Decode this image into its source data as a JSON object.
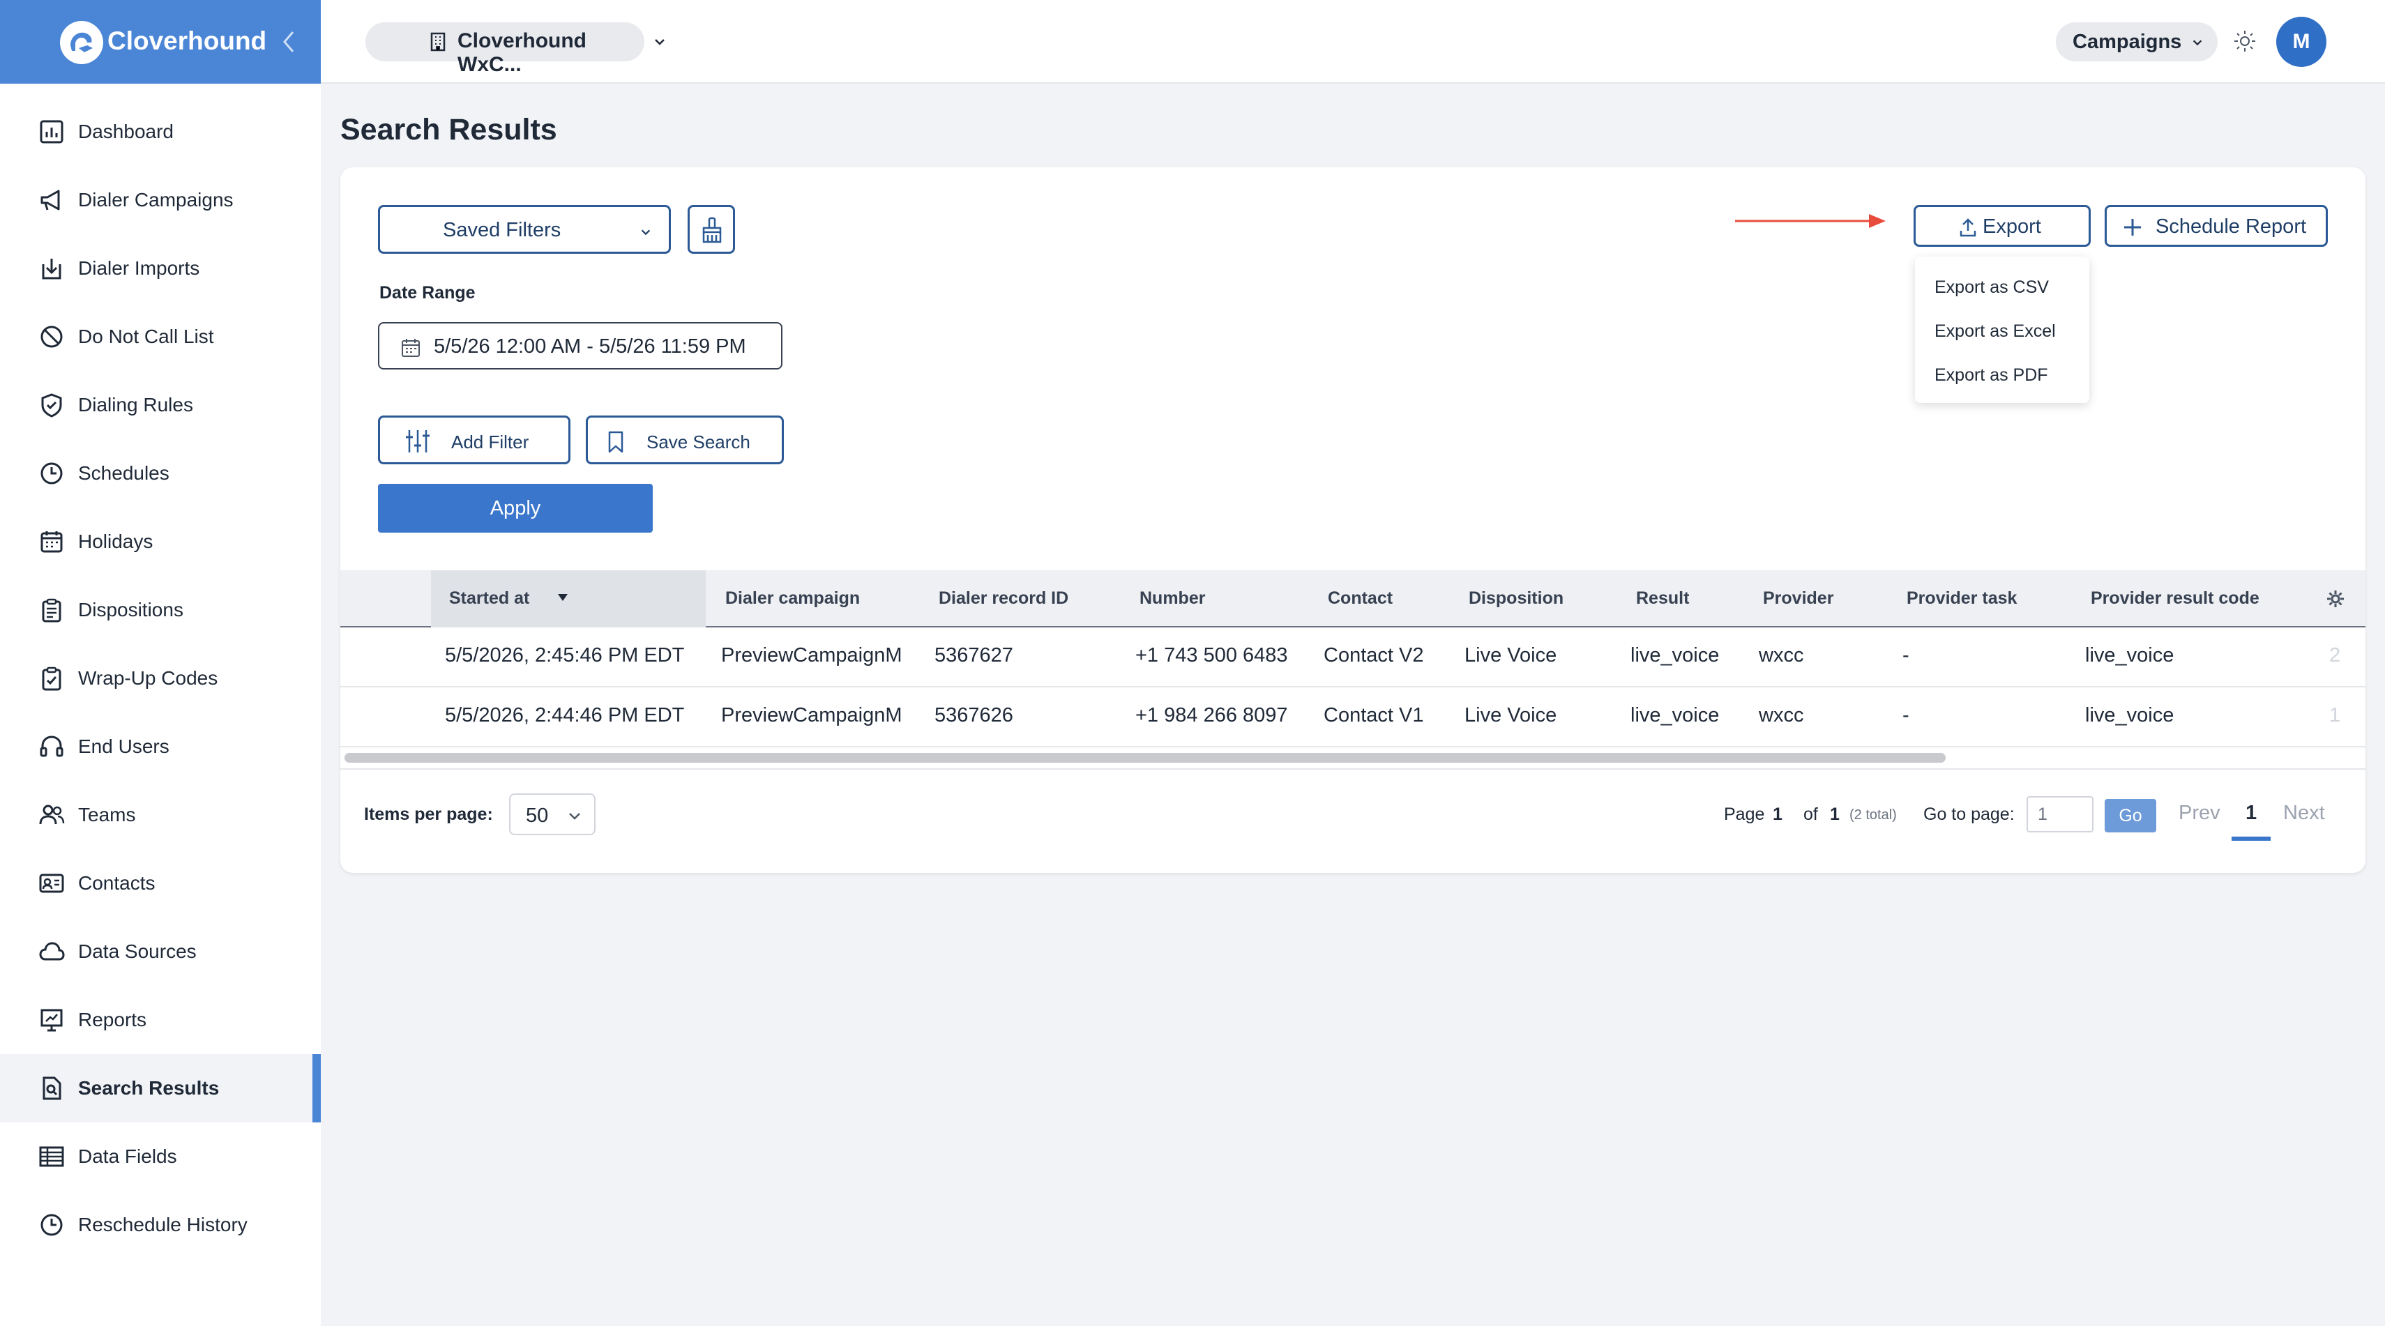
{
  "brand": {
    "name": "Cloverhound"
  },
  "sidebar": {
    "items": [
      {
        "label": "Dashboard",
        "icon": "dashboard-icon"
      },
      {
        "label": "Dialer Campaigns",
        "icon": "megaphone-icon"
      },
      {
        "label": "Dialer Imports",
        "icon": "import-icon"
      },
      {
        "label": "Do Not Call List",
        "icon": "prohibited-icon"
      },
      {
        "label": "Dialing Rules",
        "icon": "shield-check-icon"
      },
      {
        "label": "Schedules",
        "icon": "clock-icon"
      },
      {
        "label": "Holidays",
        "icon": "calendar-icon"
      },
      {
        "label": "Dispositions",
        "icon": "clipboard-icon"
      },
      {
        "label": "Wrap-Up Codes",
        "icon": "clipboard-check-icon"
      },
      {
        "label": "End Users",
        "icon": "headset-icon"
      },
      {
        "label": "Teams",
        "icon": "users-icon"
      },
      {
        "label": "Contacts",
        "icon": "contact-card-icon"
      },
      {
        "label": "Data Sources",
        "icon": "cloud-icon"
      },
      {
        "label": "Reports",
        "icon": "presentation-chart-icon"
      },
      {
        "label": "Search Results",
        "icon": "document-search-icon",
        "active": true
      },
      {
        "label": "Data Fields",
        "icon": "table-icon"
      },
      {
        "label": "Reschedule History",
        "icon": "history-clock-icon"
      }
    ]
  },
  "topbar": {
    "org_label": "Cloverhound WxC...",
    "campaigns_label": "Campaigns",
    "avatar_initial": "M"
  },
  "page": {
    "title": "Search Results"
  },
  "filters": {
    "saved_filters_label": "Saved Filters",
    "date_range_label": "Date Range",
    "date_range_value": "5/5/26 12:00 AM - 5/5/26 11:59 PM",
    "add_filter_label": "Add Filter",
    "save_search_label": "Save Search",
    "apply_label": "Apply"
  },
  "export": {
    "export_label": "Export",
    "schedule_label": "Schedule Report",
    "menu": [
      "Export as CSV",
      "Export as Excel",
      "Export as PDF"
    ],
    "arrow_color": "#e74c3c"
  },
  "table": {
    "columns": [
      "Started at",
      "Dialer campaign",
      "Dialer record ID",
      "Number",
      "Contact",
      "Disposition",
      "Result",
      "Provider",
      "Provider task",
      "Provider result code"
    ],
    "rows": [
      {
        "started_at": "5/5/2026, 2:45:46 PM EDT",
        "campaign": "PreviewCampaignM",
        "record_id": "5367627",
        "number": "+1 743 500 6483",
        "contact": "Contact V2",
        "disposition": "Live Voice",
        "result": "live_voice",
        "provider": "wxcc",
        "provider_task": "-",
        "result_code": "live_voice",
        "overflow": "2"
      },
      {
        "started_at": "5/5/2026, 2:44:46 PM EDT",
        "campaign": "PreviewCampaignM",
        "record_id": "5367626",
        "number": "+1 984 266 8097",
        "contact": "Contact V1",
        "disposition": "Live Voice",
        "result": "live_voice",
        "provider": "wxcc",
        "provider_task": "-",
        "result_code": "live_voice",
        "overflow": "1"
      }
    ]
  },
  "pagination": {
    "items_per_page_label": "Items per page:",
    "items_per_page_value": "50",
    "page_label": "Page",
    "current_page": "1",
    "of_label": "of",
    "total_pages": "1",
    "total_text": "(2 total)",
    "goto_label": "Go to page:",
    "goto_value": "1",
    "go_label": "Go",
    "prev_label": "Prev",
    "next_label": "Next"
  },
  "colors": {
    "brand": "#4a85d6",
    "primary": "#3a77cc",
    "outline": "#2c5a96"
  }
}
